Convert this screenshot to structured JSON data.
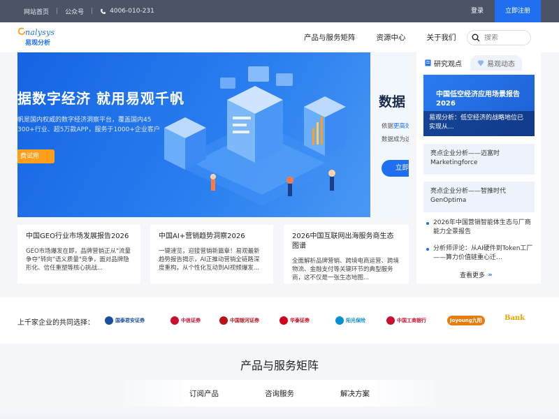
{
  "topbar": {
    "home": "网站首页",
    "official_account": "公众号",
    "phone": "4006-010-231",
    "login": "登录",
    "register": "立即注册"
  },
  "logo": {
    "en": "nalysys",
    "cn": "易观分析"
  },
  "nav": {
    "items": [
      "产品与服务矩阵",
      "资源中心",
      "关于我们"
    ],
    "search_placeholder": "搜索"
  },
  "banner": {
    "title": "据数字经济 就用易观千帆",
    "desc_line1": "帆是国内权威的数字经济洞察平台，覆盖国内45",
    "desc_line2": "300+行业、超5万款APP，服务于1000+企业客户",
    "button": "费试用",
    "right_title": "数据",
    "right_desc1_prefix": "依据",
    "right_desc1_highlight": "更高效",
    "right_desc2": "数据成为这",
    "right_button": "立即"
  },
  "side_panel": {
    "tab_research": "研究观点",
    "tab_news": "易观动态",
    "feature_title": "中国低空经济应用场景报告2026",
    "feature_caption": "易观分析：低空经济的战略地位已实现从...",
    "card1_line1": "亮点企业分析——迈富时",
    "card1_line2": "Marketingforce",
    "card2_line1": "亮点企业分析——智推时代",
    "card2_line2": "GenOptima",
    "bullet1": "2026年中国营销智能体生态与厂商能力全景报告",
    "bullet2": "分析师评论：从AI硬件到Token工厂——算力价值链重心迁...",
    "more": "查看更多"
  },
  "reports": [
    {
      "title": "中国GEO行业市场发展报告2026",
      "desc": "GEO市场爆发在即，品牌营销正从\"流量争夺\"转向\"语义质量\"竞争，面对品牌隐形化、信任重塑等核心挑战..."
    },
    {
      "title": "中国AI+营销趋势洞察2026",
      "desc": "一键速览，迎接营销新篇章！易观最新趋势报告揭示，AI正推动营销全链路深度重构，从个性化互动到AI视频爆发..."
    },
    {
      "title": "2026中国互联网出海服务商生态图谱",
      "desc": "全面解析品牌营销、跨境电商运营、跨境物流、金融支付等关键环节的典型服务商，这不仅是一张生态地图..."
    }
  ],
  "clients": {
    "label": "上千家企业的共同选择：",
    "logos": [
      {
        "name": "国泰君安证券",
        "color": "#1a4fa0"
      },
      {
        "name": "中信证券",
        "color": "#c8102e"
      },
      {
        "name": "中国银河证券",
        "color": "#b5121b"
      },
      {
        "name": "华泰证券",
        "color": "#d0021b"
      },
      {
        "name": "阳光保险",
        "color": "#0a8fd1"
      },
      {
        "name": "中国工商银行",
        "color": "#c8102e"
      },
      {
        "name": "Joyoung九阳",
        "color": "#e87d0d"
      },
      {
        "name": "Bank",
        "color": "#e4a400"
      }
    ]
  },
  "products": {
    "title": "产品与服务矩阵",
    "tabs": [
      "订阅产品",
      "咨询服务",
      "解决方案"
    ]
  },
  "colors": {
    "accent": "#1f6ff0",
    "topbar": "#4a5466",
    "orange": "#ff9e1b"
  }
}
